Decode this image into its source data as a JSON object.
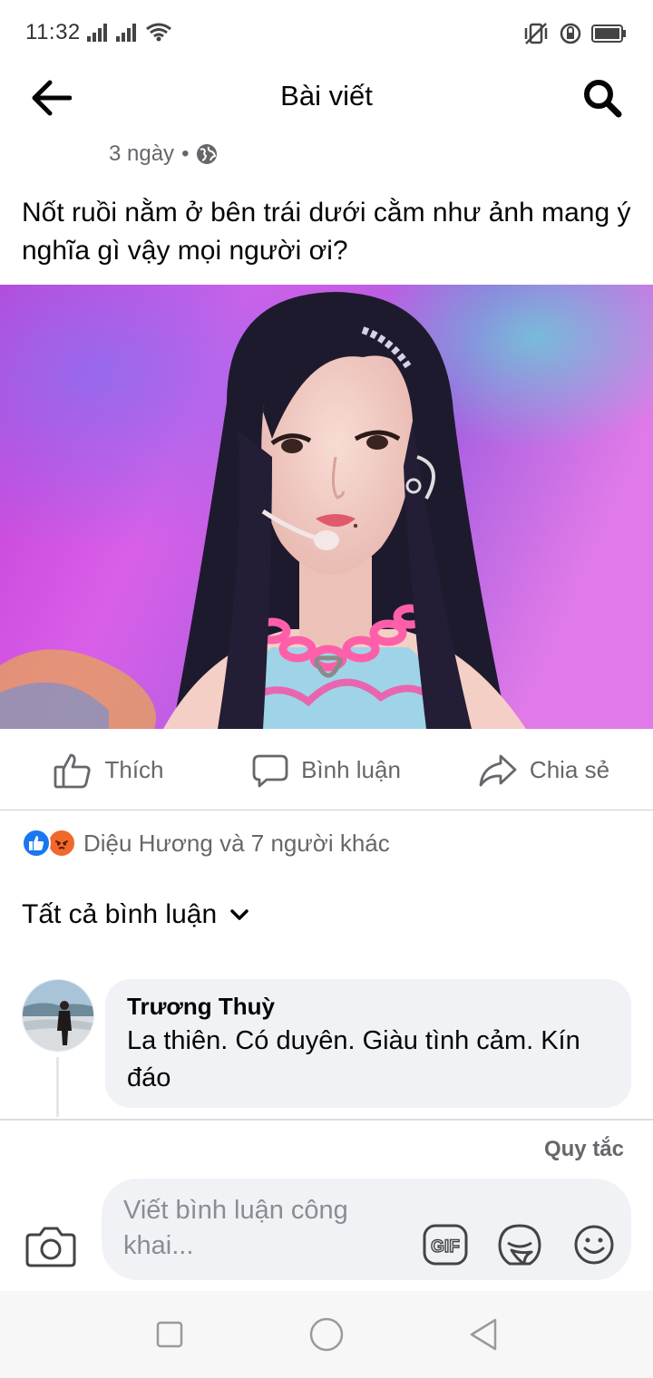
{
  "status_bar": {
    "time": "11:32"
  },
  "header": {
    "title": "Bài viết"
  },
  "post": {
    "time_ago": "3 ngày",
    "separator": "•",
    "text": "Nốt ruồi nằm ở bên trái dưới cằm như ảnh mang ý nghĩa gì vậy mọi người ơi?"
  },
  "actions": {
    "like": "Thích",
    "comment": "Bình luận",
    "share": "Chia sẻ"
  },
  "reactions": {
    "summary": "Diệu Hương và 7 người khác"
  },
  "comments_filter": {
    "label": "Tất cả bình luận"
  },
  "comments": [
    {
      "author": "Trương Thuỳ",
      "text": "La thiên. Có duyên. Giàu tình cảm. Kín đáo"
    }
  ],
  "rules_link": "Quy tắc",
  "composer": {
    "placeholder": "Viết bình luận công khai..."
  },
  "colors": {
    "accent": "#1877f2",
    "secondary_text": "#65676b",
    "bubble": "#f0f2f5"
  },
  "icons": [
    "back-arrow-icon",
    "search-icon",
    "globe-icon",
    "like-icon",
    "comment-icon",
    "share-icon",
    "camera-icon",
    "gif-icon",
    "sticker-icon",
    "emoji-icon"
  ]
}
